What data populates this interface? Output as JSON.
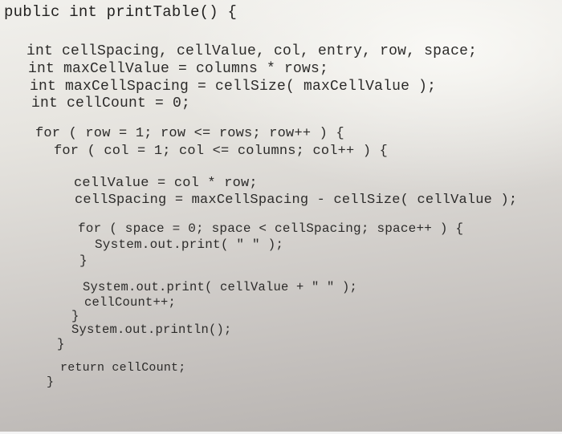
{
  "document": {
    "code_lines": [
      "public int printTable() {",
      "int cellSpacing, cellValue, col, entry, row, space;",
      "int maxCellValue = columns * rows;",
      "int maxCellSpacing = cellSize( maxCellValue );",
      "int cellCount = 0;",
      "for ( row = 1; row <= rows; row++ ) {",
      "for ( col = 1; col <= columns; col++ ) {",
      "cellValue = col * row;",
      "cellSpacing = maxCellSpacing - cellSize( cellValue );",
      "for ( space = 0; space < cellSpacing; space++ ) {",
      "System.out.print( \" \" );",
      "}",
      "System.out.print( cellValue + \" \" );",
      "cellCount++;",
      "}",
      "System.out.println();",
      "}",
      "return cellCount;",
      "}"
    ]
  }
}
